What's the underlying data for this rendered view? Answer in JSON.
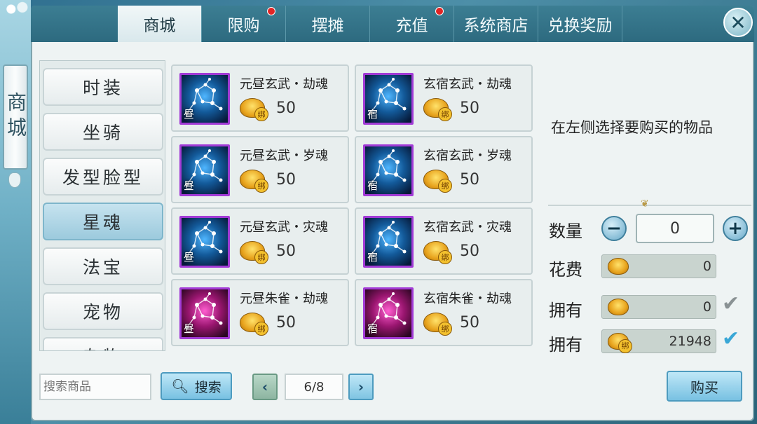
{
  "banner": {
    "title": "商城"
  },
  "tabs": [
    {
      "label": "商城",
      "active": true,
      "badge": false
    },
    {
      "label": "限购",
      "active": false,
      "badge": true
    },
    {
      "label": "摆摊",
      "active": false,
      "badge": false
    },
    {
      "label": "充值",
      "active": false,
      "badge": true
    },
    {
      "label": "系统商店",
      "active": false,
      "badge": false
    },
    {
      "label": "兑换奖励",
      "active": false,
      "badge": false
    }
  ],
  "close_icon": "close-icon",
  "categories": [
    {
      "label": "时装",
      "active": false
    },
    {
      "label": "坐骑",
      "active": false
    },
    {
      "label": "发型脸型",
      "active": false
    },
    {
      "label": "星魂",
      "active": true
    },
    {
      "label": "法宝",
      "active": false
    },
    {
      "label": "宠物",
      "active": false
    },
    {
      "label": "杂物",
      "active": false
    }
  ],
  "items": [
    {
      "name": "元昼玄武・劫魂",
      "price": "50",
      "tag": "昼",
      "color": "blue",
      "bind": "绑"
    },
    {
      "name": "玄宿玄武・劫魂",
      "price": "50",
      "tag": "宿",
      "color": "blue",
      "bind": "绑"
    },
    {
      "name": "元昼玄武・岁魂",
      "price": "50",
      "tag": "昼",
      "color": "blue",
      "bind": "绑"
    },
    {
      "name": "玄宿玄武・岁魂",
      "price": "50",
      "tag": "宿",
      "color": "blue",
      "bind": "绑"
    },
    {
      "name": "元昼玄武・灾魂",
      "price": "50",
      "tag": "昼",
      "color": "blue",
      "bind": "绑"
    },
    {
      "name": "玄宿玄武・灾魂",
      "price": "50",
      "tag": "宿",
      "color": "blue",
      "bind": "绑"
    },
    {
      "name": "元昼朱雀・劫魂",
      "price": "50",
      "tag": "昼",
      "color": "pink",
      "bind": "绑"
    },
    {
      "name": "玄宿朱雀・劫魂",
      "price": "50",
      "tag": "宿",
      "color": "pink",
      "bind": "绑"
    }
  ],
  "detail": {
    "hint": "在左侧选择要购买的物品",
    "qty_label": "数量",
    "qty_value": "0",
    "cost_label": "花费",
    "cost_value": "0",
    "own1_label": "拥有",
    "own1_value": "0",
    "own2_label": "拥有",
    "own2_value": "21948",
    "bind_label": "绑"
  },
  "bottom": {
    "search_placeholder": "搜索商品",
    "search_button": "搜索",
    "page": "6/8",
    "buy_button": "购买"
  },
  "colors": {
    "accent": "#78c1e2",
    "badge": "#e32525",
    "icon_border": "#a23bd6"
  }
}
